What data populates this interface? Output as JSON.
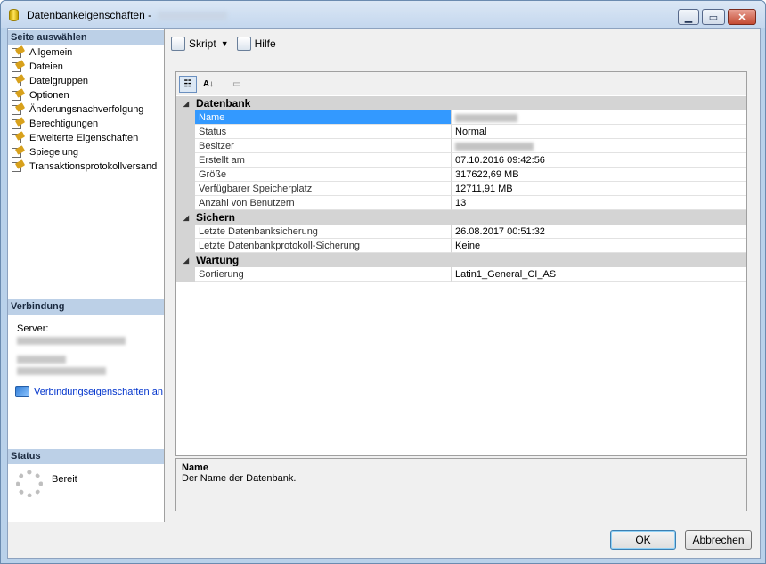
{
  "window": {
    "title": "Datenbankeigenschaften - ",
    "minimize": "▁",
    "maximize": "▭",
    "close": "✕"
  },
  "left": {
    "select_page_header": "Seite auswählen",
    "pages": [
      {
        "label": "Allgemein"
      },
      {
        "label": "Dateien"
      },
      {
        "label": "Dateigruppen"
      },
      {
        "label": "Optionen"
      },
      {
        "label": "Änderungsnachverfolgung"
      },
      {
        "label": "Berechtigungen"
      },
      {
        "label": "Erweiterte Eigenschaften"
      },
      {
        "label": "Spiegelung"
      },
      {
        "label": "Transaktionsprotokollversand"
      }
    ],
    "connection_header": "Verbindung",
    "server_label": "Server:",
    "connection_link": "Verbindungseigenschaften an",
    "status_header": "Status",
    "status_text": "Bereit"
  },
  "toolbar": {
    "script_label": "Skript",
    "help_label": "Hilfe"
  },
  "grid": {
    "categories": [
      {
        "name": "Datenbank",
        "rows": [
          {
            "name": "Name",
            "value": ""
          },
          {
            "name": "Status",
            "value": "Normal"
          },
          {
            "name": "Besitzer",
            "value": ""
          },
          {
            "name": "Erstellt am",
            "value": "07.10.2016 09:42:56"
          },
          {
            "name": "Größe",
            "value": "317622,69 MB"
          },
          {
            "name": "Verfügbarer Speicherplatz",
            "value": "12711,91 MB"
          },
          {
            "name": "Anzahl von Benutzern",
            "value": "13"
          }
        ]
      },
      {
        "name": "Sichern",
        "rows": [
          {
            "name": "Letzte Datenbanksicherung",
            "value": "26.08.2017 00:51:32"
          },
          {
            "name": "Letzte Datenbankprotokoll-Sicherung",
            "value": "Keine"
          }
        ]
      },
      {
        "name": "Wartung",
        "rows": [
          {
            "name": "Sortierung",
            "value": "Latin1_General_CI_AS"
          }
        ]
      }
    ]
  },
  "description": {
    "title": "Name",
    "text": "Der Name der Datenbank."
  },
  "buttons": {
    "ok": "OK",
    "cancel": "Abbrechen"
  }
}
